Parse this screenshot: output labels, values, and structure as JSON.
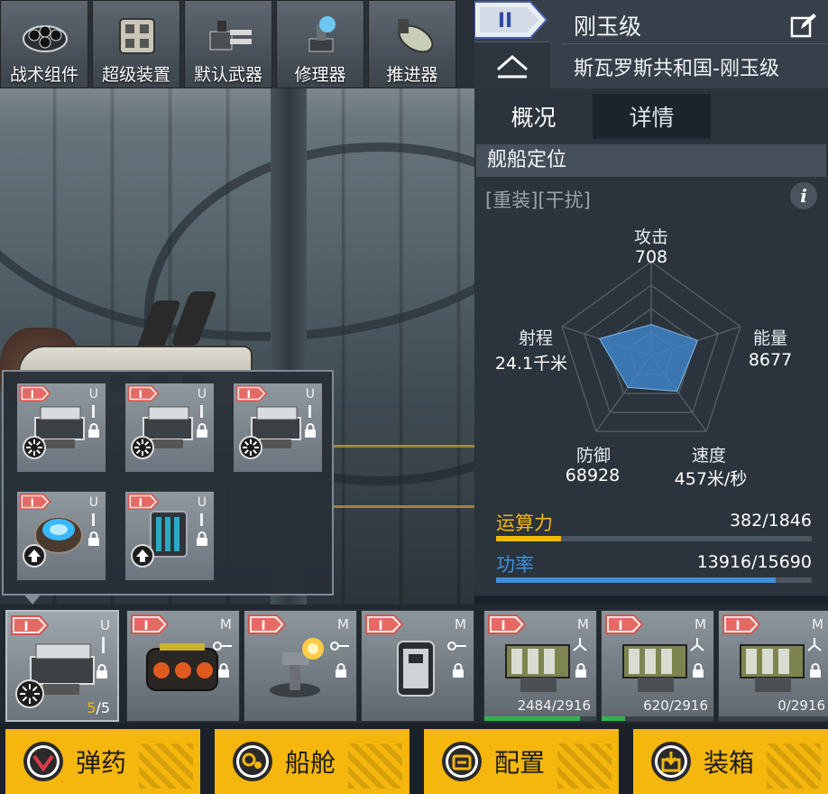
{
  "toolbar": {
    "items": [
      {
        "label": "战术组件",
        "icon": "tactical-component-icon"
      },
      {
        "label": "超级装置",
        "icon": "super-device-icon"
      },
      {
        "label": "默认武器",
        "icon": "default-weapon-icon"
      },
      {
        "label": "修理器",
        "icon": "repairer-icon"
      },
      {
        "label": "推进器",
        "icon": "thruster-icon"
      }
    ]
  },
  "header": {
    "tier": "II",
    "ship_class": "刚玉级",
    "ship_full_name": "斯瓦罗斯共和国-刚玉级"
  },
  "tabs": [
    {
      "label": "概况",
      "active": true
    },
    {
      "label": "详情",
      "active": false
    }
  ],
  "section": {
    "title": "舰船定位",
    "roles": "[重装][干扰]",
    "info_symbol": "i"
  },
  "stats": {
    "attack": {
      "label": "攻击",
      "value": "708"
    },
    "energy": {
      "label": "能量",
      "value": "8677"
    },
    "speed": {
      "label": "速度",
      "value": "457米/秒"
    },
    "defense": {
      "label": "防御",
      "value": "68928"
    },
    "range": {
      "label": "射程",
      "value": "24.1千米"
    }
  },
  "bars": {
    "compute": {
      "label": "运算力",
      "value": "382/1846",
      "fraction": 0.207,
      "color": "#f5b70e"
    },
    "power": {
      "label": "功率",
      "value": "13916/15690",
      "fraction": 0.887,
      "color": "#3f8fdc"
    }
  },
  "popup": {
    "cards": [
      {
        "tier": "I",
        "slot": "U",
        "type": "turret"
      },
      {
        "tier": "I",
        "slot": "U",
        "type": "turret"
      },
      {
        "tier": "I",
        "slot": "U",
        "type": "turret"
      },
      {
        "tier": "I",
        "slot": "U",
        "type": "shield-emitter"
      },
      {
        "tier": "I",
        "slot": "U",
        "type": "battery"
      }
    ]
  },
  "modules": [
    {
      "tier": "I",
      "slot": "U",
      "count": "5/5"
    },
    {
      "tier": "I",
      "slot": "M",
      "count": ""
    },
    {
      "tier": "I",
      "slot": "M",
      "count": ""
    },
    {
      "tier": "I",
      "slot": "M",
      "count": ""
    },
    {
      "tier": "I",
      "slot": "M",
      "ammo": "2484/2916",
      "fraction": 0.852
    },
    {
      "tier": "I",
      "slot": "M",
      "ammo": "620/2916",
      "fraction": 0.213
    },
    {
      "tier": "I",
      "slot": "M",
      "ammo": "0/2916",
      "fraction": 0.0
    }
  ],
  "actions": [
    {
      "label": "弹药",
      "icon": "ammo-icon"
    },
    {
      "label": "船舱",
      "icon": "cabin-icon"
    },
    {
      "label": "配置",
      "icon": "config-icon"
    },
    {
      "label": "装箱",
      "icon": "packing-icon"
    }
  ],
  "colors": {
    "accent_yellow": "#f5b70e",
    "accent_blue": "#3f8fdc",
    "radar_fill": "#3f82c4",
    "tier_badge": "#e56a63"
  }
}
